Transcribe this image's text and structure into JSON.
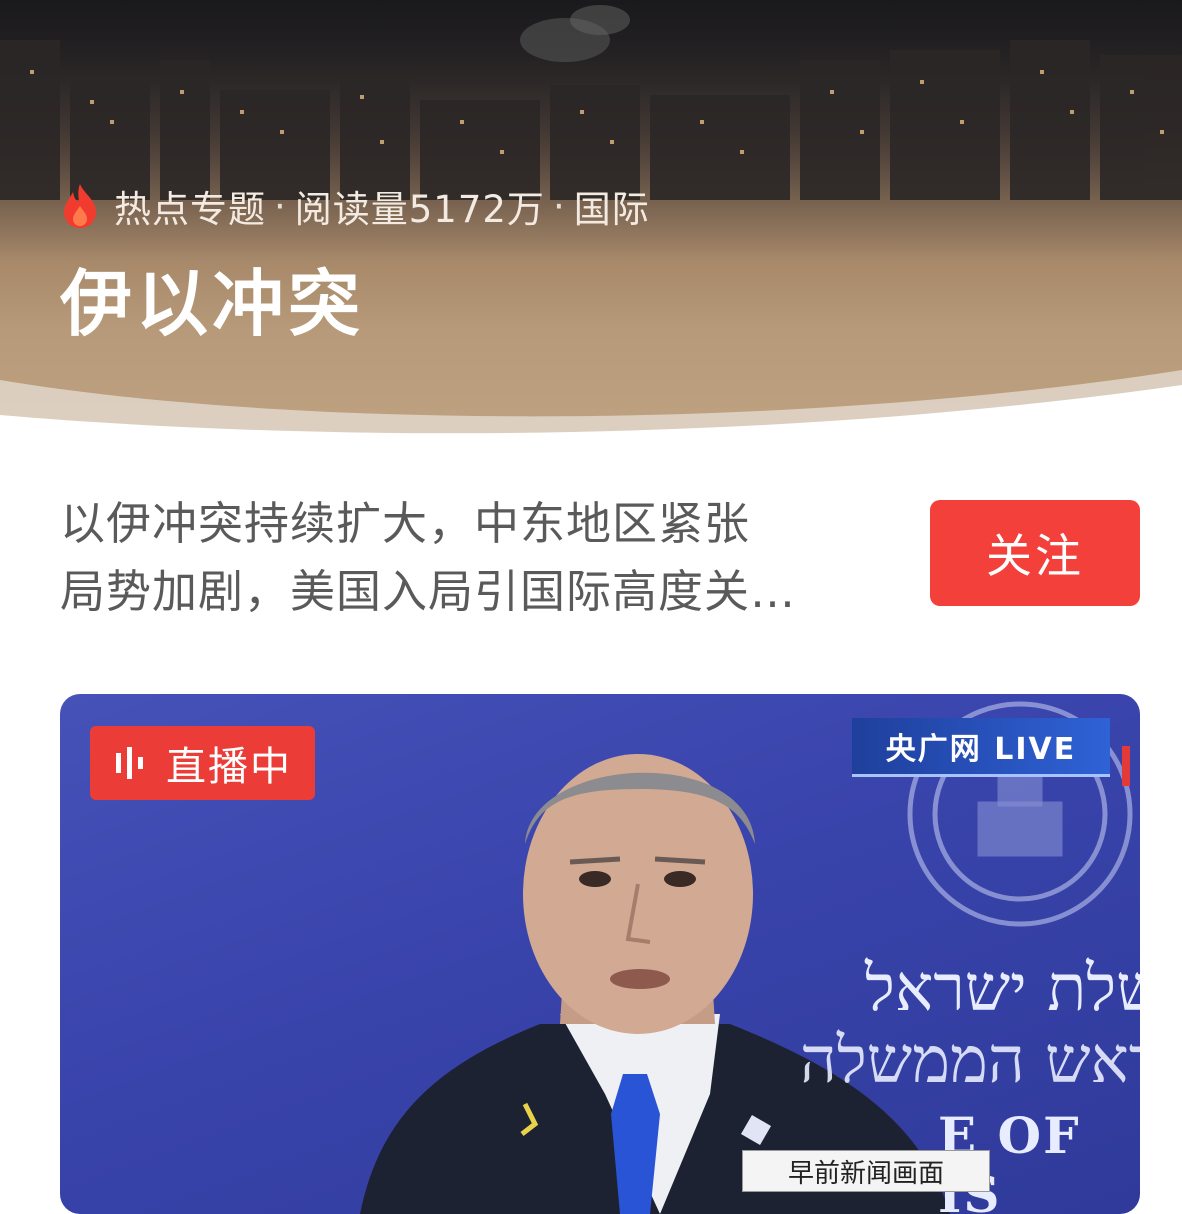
{
  "header": {
    "hot_label": "热点专题",
    "separator": "·",
    "read_count": "阅读量5172万",
    "category": "国际",
    "title": "伊以冲突",
    "flame_icon": "flame-icon"
  },
  "topic": {
    "description_line1": "以伊冲突持续扩大，中东地区紧张",
    "description_line2": "局势加剧，美国入局引国际高度关…",
    "follow_label": "关注"
  },
  "video": {
    "live_label": "直播中",
    "channel_logo": "央广网 LIVE",
    "hebrew_line1": "ממשלת ישראל",
    "hebrew_line2": "ראש הממשלה",
    "seal_text": "ישראל",
    "english_fragment": "E OF IS",
    "caption": "早前新闻画面"
  },
  "colors": {
    "accent_red": "#f3403b",
    "live_red": "#eb3c37",
    "hero_tan": "#b79a79",
    "video_blue": "#3a45ad"
  }
}
